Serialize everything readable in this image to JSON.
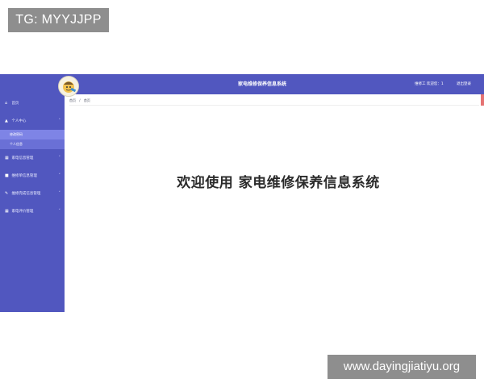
{
  "watermarks": {
    "top": "TG: MYYJJPP",
    "bottom": "www.dayingjiatiyu.org"
  },
  "header": {
    "title": "家电维修保养信息系统",
    "user_info": "维修工 欢迎您：1",
    "logout_label": "退出登录",
    "avatar_icon": "cartoon-avatar-icon"
  },
  "sidebar": {
    "items": [
      {
        "label": "首页",
        "icon": "home-icon",
        "glyph": "⌂",
        "has_children": false
      },
      {
        "label": "个人中心",
        "icon": "user-icon",
        "glyph": "▲",
        "has_children": true,
        "expanded": true,
        "children": [
          {
            "label": "修改密码"
          },
          {
            "label": "个人信息"
          }
        ]
      },
      {
        "label": "家电信息管理",
        "icon": "grid-icon",
        "glyph": "▦",
        "has_children": true
      },
      {
        "label": "维修单信息管理",
        "icon": "message-icon",
        "glyph": "■",
        "has_children": true
      },
      {
        "label": "维修完成信息管理",
        "icon": "edit-icon",
        "glyph": "✎",
        "has_children": true
      },
      {
        "label": "家电评价管理",
        "icon": "grid-icon",
        "glyph": "▦",
        "has_children": true
      }
    ]
  },
  "breadcrumb": {
    "root": "首页",
    "separator": "/",
    "current": "首页"
  },
  "main": {
    "welcome": "欢迎使用 家电维修保养信息系统"
  },
  "colors": {
    "sidebar": "#5157bf",
    "submenu": "#6a70d6",
    "submenu_active": "#7e84e6"
  }
}
